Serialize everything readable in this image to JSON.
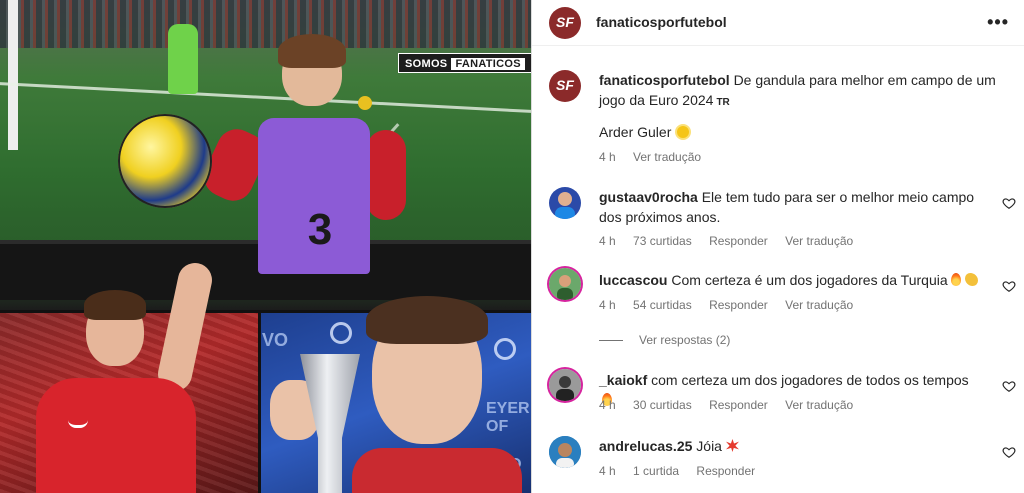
{
  "image": {
    "watermark_a": "SOMOS",
    "watermark_b": "FANATICOS",
    "bib_number": "3",
    "side_text_1": "VO",
    "side_text_2": "EYER OF",
    "side_text_3": "IVO"
  },
  "header": {
    "avatar_text": "SF",
    "username": "fanaticosporfutebol",
    "more_icon": "more-horizontal-icon"
  },
  "caption": {
    "avatar_text": "SF",
    "username": "fanaticosporfutebol",
    "text": "De gandula para melhor em campo de um jogo da Euro 2024",
    "tr_badge": "TR",
    "name_line": "Arder Guler",
    "time": "4 h",
    "translate": "Ver tradução"
  },
  "comments": [
    {
      "username": "gustaav0rocha",
      "text": "Ele tem tudo para ser o melhor meio campo dos próximos anos.",
      "time": "4 h",
      "likes": "73 curtidas",
      "reply": "Responder",
      "translate": "Ver tradução",
      "avatar_color": "#2b4aa8"
    },
    {
      "username": "luccascou",
      "text": "Com certeza é um dos jogadores da Turquia",
      "time": "4 h",
      "likes": "54 curtidas",
      "reply": "Responder",
      "translate": "Ver tradução",
      "avatar_color": "#3c7d3c",
      "view_replies": "Ver respostas (2)"
    },
    {
      "username": "_kaiokf",
      "text": "com certeza um dos jogadores de todos os tempos",
      "time": "4 h",
      "likes": "30 curtidas",
      "reply": "Responder",
      "translate": "Ver tradução",
      "avatar_color": "#555555"
    },
    {
      "username": "andrelucas.25",
      "text": "Jóia",
      "time": "4 h",
      "likes": "1 curtida",
      "reply": "Responder",
      "avatar_color": "#2a7fbf"
    }
  ],
  "colors": {
    "brand": "#8b2a2a",
    "meta_text": "#737373",
    "story_ring": "#d6249f"
  }
}
